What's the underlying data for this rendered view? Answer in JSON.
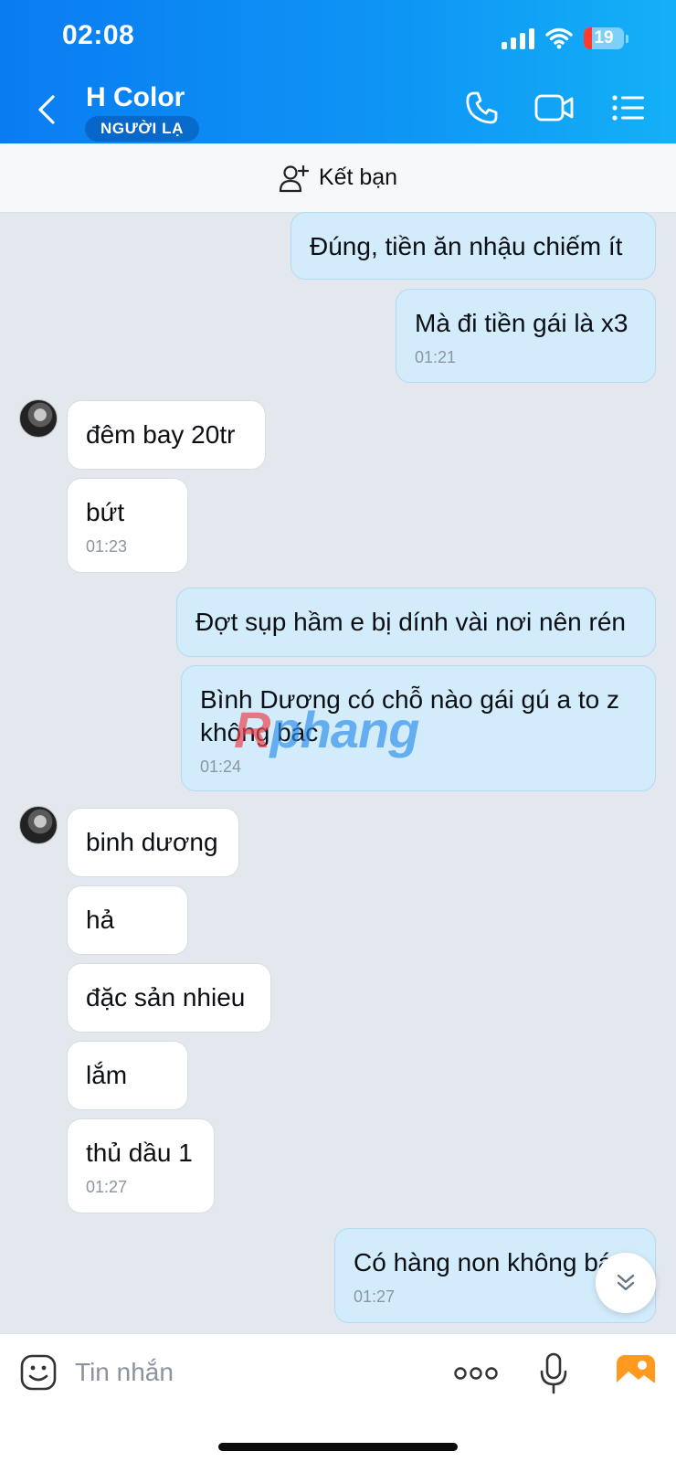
{
  "status_bar": {
    "time": "02:08",
    "battery": "19"
  },
  "header": {
    "contact_name": "H Color",
    "badge": "NGƯỜI LẠ",
    "icons": [
      "back-arrow-icon",
      "phone-icon",
      "video-call-icon",
      "menu-list-icon"
    ]
  },
  "friend_bar": {
    "label": "Kết bạn",
    "icon": "add-person-icon"
  },
  "messages": [
    {
      "dir": "out",
      "text": "Đúng, tiền ăn nhậu chiếm ít",
      "time": ""
    },
    {
      "dir": "out",
      "text": "Mà đi tiền gái là x3",
      "time": "01:21"
    },
    {
      "dir": "in",
      "text": "đêm bay 20tr",
      "time": ""
    },
    {
      "dir": "in",
      "text": "bứt",
      "time": "01:23"
    },
    {
      "dir": "out",
      "text": "Đợt sụp hầm e bị dính vài nơi nên rén",
      "time": ""
    },
    {
      "dir": "out",
      "text": "Bình Dương có chỗ nào gái gú a to z\nkhông bác",
      "time": "01:24"
    },
    {
      "dir": "in",
      "text": "binh dương",
      "time": ""
    },
    {
      "dir": "in",
      "text": "hả",
      "time": ""
    },
    {
      "dir": "in",
      "text": "đặc sản nhieu",
      "time": ""
    },
    {
      "dir": "in",
      "text": "lắm",
      "time": ""
    },
    {
      "dir": "in",
      "text": "thủ dầu 1",
      "time": "01:27"
    },
    {
      "dir": "out",
      "text": "Có hàng non không bá",
      "time": "01:27"
    }
  ],
  "watermark": {
    "part1": "R",
    "part2": "phang"
  },
  "input_bar": {
    "placeholder": "Tin nhắn",
    "icons": [
      "sticker-icon",
      "more-options-icon",
      "microphone-icon",
      "image-gallery-icon"
    ]
  },
  "colors": {
    "header_start": "#0a7cf2",
    "header_end": "#14b0f7",
    "outgoing_bubble": "#d3ecfb",
    "incoming_bubble": "#ffffff",
    "background": "#e3e7ee"
  }
}
